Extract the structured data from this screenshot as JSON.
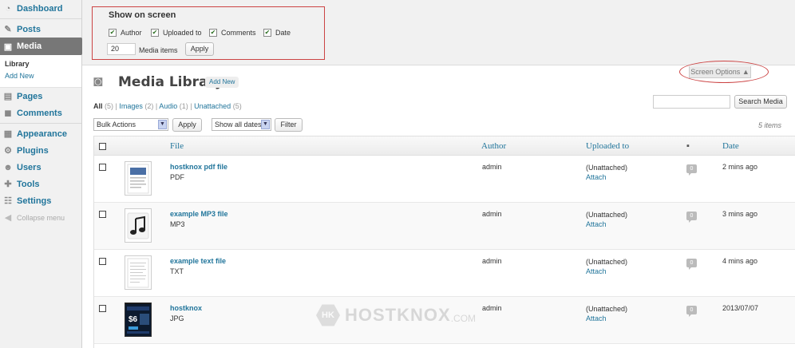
{
  "sidebar": {
    "items": [
      {
        "label": "Dashboard",
        "icon": "dashboard-icon"
      },
      {
        "label": "Posts",
        "icon": "posts-icon"
      },
      {
        "label": "Media",
        "icon": "media-icon"
      },
      {
        "label": "Pages",
        "icon": "pages-icon"
      },
      {
        "label": "Comments",
        "icon": "comments-icon"
      },
      {
        "label": "Appearance",
        "icon": "appearance-icon"
      },
      {
        "label": "Plugins",
        "icon": "plugins-icon"
      },
      {
        "label": "Users",
        "icon": "users-icon"
      },
      {
        "label": "Tools",
        "icon": "tools-icon"
      },
      {
        "label": "Settings",
        "icon": "settings-icon"
      }
    ],
    "media_submenu": {
      "library": "Library",
      "add_new": "Add New"
    },
    "collapse": "Collapse menu"
  },
  "screen_options": {
    "title": "Show on screen",
    "columns": [
      "Author",
      "Uploaded to",
      "Comments",
      "Date"
    ],
    "per_page_value": "20",
    "per_page_label": "Media items",
    "apply_label": "Apply",
    "tab_label": "Screen Options"
  },
  "page": {
    "title": "Media Library",
    "add_new": "Add New"
  },
  "filters": {
    "all": "All",
    "all_count": "(5)",
    "images": "Images",
    "images_count": "(2)",
    "audio": "Audio",
    "audio_count": "(1)",
    "unattached": "Unattached",
    "unattached_count": "(5)"
  },
  "search": {
    "button": "Search Media"
  },
  "bulk": {
    "select": "Bulk Actions",
    "apply": "Apply"
  },
  "date_filter": {
    "select": "Show all dates",
    "filter": "Filter"
  },
  "items_count": "5 items",
  "table": {
    "headers": {
      "file": "File",
      "author": "Author",
      "uploaded": "Uploaded to",
      "date": "Date"
    },
    "rows": [
      {
        "name": "hostknox pdf file",
        "type": "PDF",
        "author": "admin",
        "uploaded": "(Unattached)",
        "attach": "Attach",
        "comments": "0",
        "date": "2 mins ago",
        "thumb": "pdf-thumbnail"
      },
      {
        "name": "example MP3 file",
        "type": "MP3",
        "author": "admin",
        "uploaded": "(Unattached)",
        "attach": "Attach",
        "comments": "0",
        "date": "3 mins ago",
        "thumb": "audio-thumbnail"
      },
      {
        "name": "example text file",
        "type": "TXT",
        "author": "admin",
        "uploaded": "(Unattached)",
        "attach": "Attach",
        "comments": "0",
        "date": "4 mins ago",
        "thumb": "text-thumbnail"
      },
      {
        "name": "hostknox",
        "type": "JPG",
        "author": "admin",
        "uploaded": "(Unattached)",
        "attach": "Attach",
        "comments": "0",
        "date": "2013/07/07",
        "thumb": "image-thumbnail"
      }
    ]
  },
  "watermark": {
    "mark": "HK",
    "text": "HOSTKNOX",
    "suffix": ".COM"
  },
  "colors": {
    "link": "#21759b",
    "current_menu": "#777777",
    "annotation": "#cc4444"
  }
}
